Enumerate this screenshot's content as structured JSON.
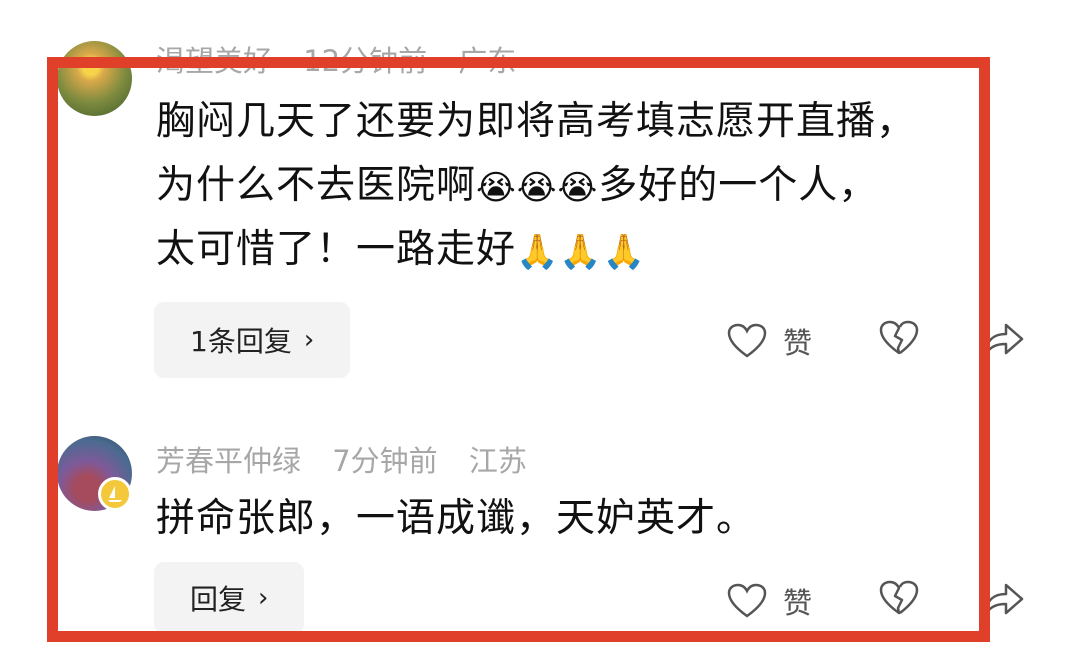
{
  "comments": [
    {
      "user": "渴望美好",
      "time": "12分钟前",
      "location": "广东",
      "text_line1": "胸闷几天了还要为即将高考填志愿开直播，",
      "text_line2a": "为什么不去医院啊",
      "text_line2b": "多好的一个人，",
      "text_line3": "太可惜了！一路走好",
      "emoji_cry": "😭",
      "emoji_pray": "🙏",
      "reply_label": "1条回复",
      "like_label": "赞"
    },
    {
      "user": "芳春平仲绿",
      "time": "7分钟前",
      "location": "江苏",
      "text_line1": "拼命张郎，一语成谶，天妒英才。",
      "reply_label": "回复",
      "like_label": "赞"
    }
  ],
  "icons": {
    "chevron": "›",
    "highlight_color": "#e0402a"
  }
}
